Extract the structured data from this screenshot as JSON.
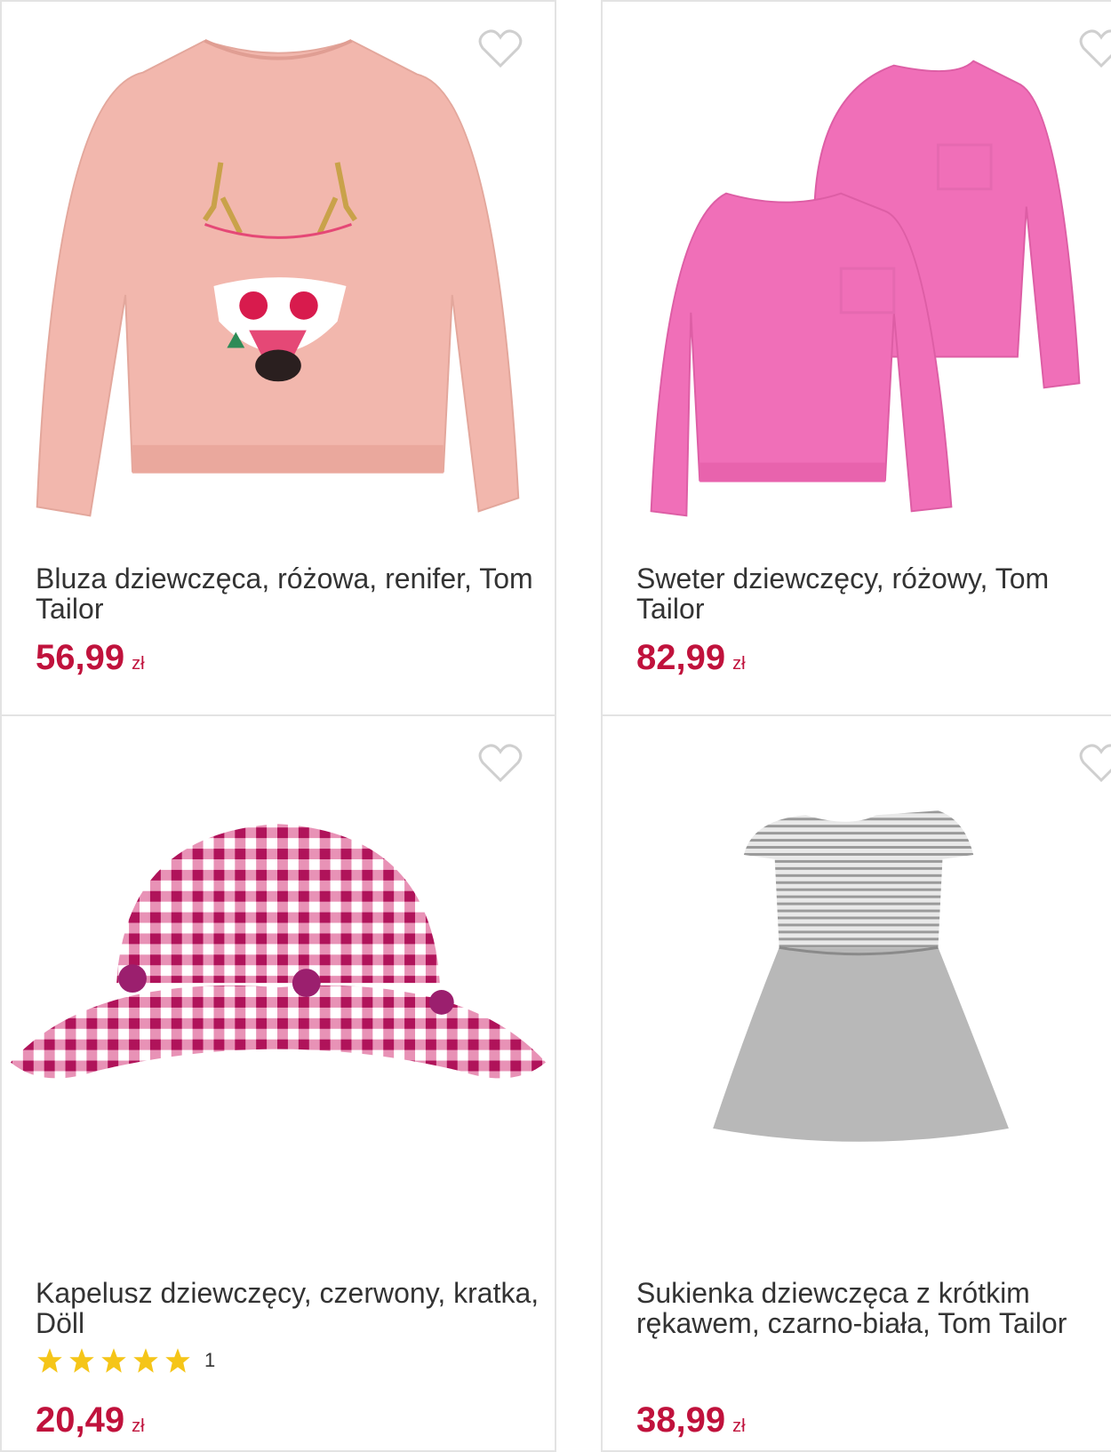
{
  "products": [
    {
      "title": "Bluza dziewczęca, różowa, renifer, Tom Tailor",
      "price": "56,99",
      "currency": "zł",
      "image_icon": "pink-reindeer-sweatshirt"
    },
    {
      "title": "Sweter dziewczęcy, różowy, Tom Tailor",
      "price": "82,99",
      "currency": "zł",
      "image_icon": "pink-knit-sweaters"
    },
    {
      "title": "Kapelusz dziewczęcy, czerwony, kratka, Döll",
      "price": "20,49",
      "currency": "zł",
      "rating": 5,
      "rating_count": "1",
      "image_icon": "gingham-bucket-hat"
    },
    {
      "title": "Sukienka dziewczęca z krótkim rękawem, czarno-biała, Tom Tailor",
      "price": "38,99",
      "currency": "zł",
      "image_icon": "striped-grey-dress"
    }
  ],
  "colors": {
    "price": "#c0123c",
    "star": "#f5c518",
    "border": "#e3e3e3",
    "heart": "#cfcfcf"
  }
}
